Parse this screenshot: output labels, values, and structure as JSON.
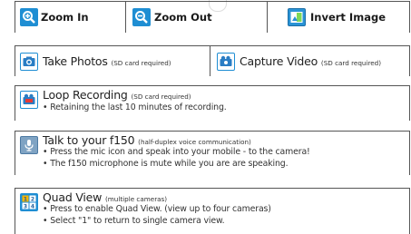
{
  "top_row": {
    "zoom_in": {
      "label": "Zoom In",
      "icon": "zoom-in-icon"
    },
    "zoom_out": {
      "label": "Zoom Out",
      "icon": "zoom-out-icon"
    },
    "invert_image": {
      "label": "Invert Image",
      "icon": "invert-image-icon"
    }
  },
  "capture_row": {
    "take_photos": {
      "label": "Take Photos",
      "note": "(SD card required)",
      "icon": "camera-icon"
    },
    "capture_video": {
      "label": "Capture Video",
      "note": "(SD card required)",
      "icon": "video-camera-icon"
    }
  },
  "loop_recording": {
    "label": "Loop Recording",
    "note": "(SD card required)",
    "bullets": [
      "• Retaining the last 10 minutes of recording."
    ],
    "icon": "loop-recording-icon"
  },
  "talk": {
    "label": "Talk to your f150",
    "note": "(half-duplex voice communication)",
    "bullets": [
      "• Press the mic icon and speak into your mobile - to the camera!",
      "• The f150 microphone is mute while you are are speaking."
    ],
    "icon": "microphone-icon"
  },
  "quad_view": {
    "label": "Quad View",
    "note": "(multiple cameras)",
    "bullets": [
      "• Press to enable Quad View. (view up to four cameras)",
      "• Select \"1\" to return to single camera view."
    ],
    "icon": "quad-view-icon"
  },
  "colors": {
    "icon_blue": "#1f8ed3",
    "border": "#555555"
  }
}
